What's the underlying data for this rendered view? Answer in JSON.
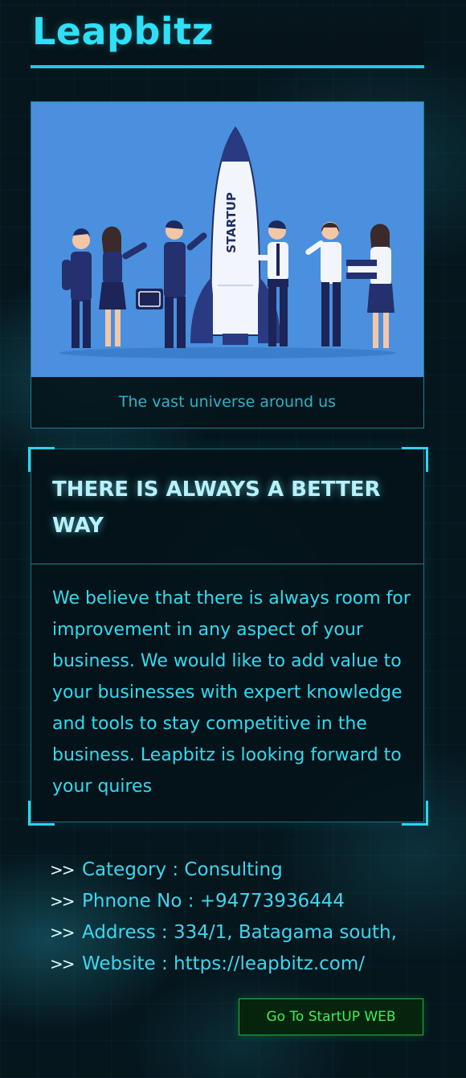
{
  "header": {
    "brand": "Leapbitz"
  },
  "hero": {
    "illustration_text": "STARTUP",
    "caption": "The vast universe around us"
  },
  "info": {
    "title": "THERE IS ALWAYS A BETTER WAY",
    "body": "We believe that there is always room for improvement in any aspect of your business. We would like to add value to your businesses with expert knowledge and tools to stay competitive in the business. Leapbitz is looking forward to your quires"
  },
  "details": {
    "marker": ">>",
    "category": "Category : Consulting",
    "phone": "Phnone No : +94773936444",
    "address": "Address : 334/1, Batagama south,",
    "website": "Website : https://leapbitz.com/"
  },
  "cta": {
    "label": "Go To StartUP WEB"
  },
  "colors": {
    "accent": "#2fe0f6",
    "background": "#05161d",
    "illustration_bg": "#4a90df",
    "cta_green": "#3fee5a"
  }
}
